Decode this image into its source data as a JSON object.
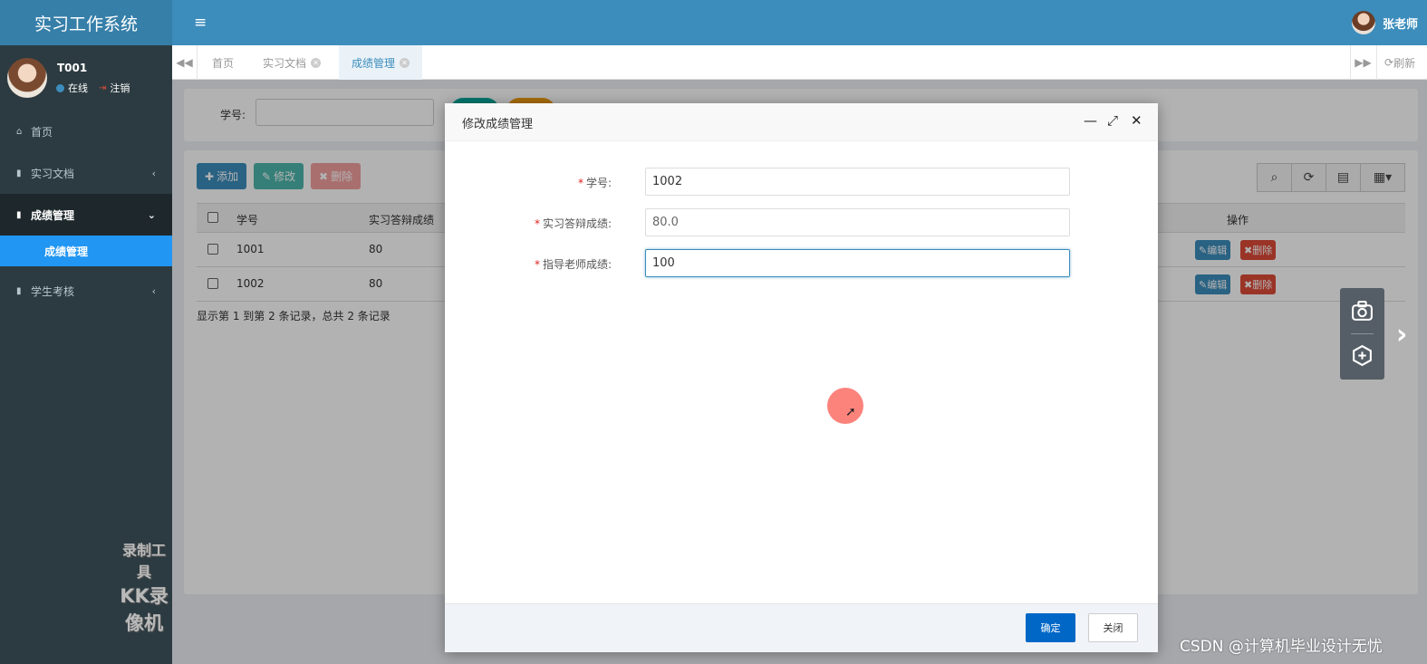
{
  "app": {
    "title": "实习工作系统"
  },
  "header": {
    "user_name": "张老师"
  },
  "sidebar": {
    "user": {
      "id": "T001",
      "status": "在线",
      "logout": "注销"
    },
    "items": [
      {
        "label": "首页",
        "icon": "home-icon"
      },
      {
        "label": "实习文档",
        "icon": "book-icon",
        "chevron": "‹"
      },
      {
        "label": "成绩管理",
        "icon": "book-icon",
        "chevron": "⌄"
      },
      {
        "label": "学生考核",
        "icon": "book-icon",
        "chevron": "‹"
      }
    ],
    "subitem": "成绩管理"
  },
  "tabs": [
    {
      "label": "首页"
    },
    {
      "label": "实习文档"
    },
    {
      "label": "成绩管理"
    }
  ],
  "tabbar": {
    "refresh": "刷新"
  },
  "search": {
    "label": "学号:"
  },
  "toolbar": {
    "add": "添加",
    "edit": "修改",
    "delete": "删除"
  },
  "table": {
    "headers": {
      "check": "",
      "student_id": "学号",
      "defense_score": "实习答辩成绩",
      "actions": "操作"
    },
    "rows": [
      {
        "student_id": "1001",
        "defense_score": "80",
        "edit": "编辑",
        "delete": "删除"
      },
      {
        "student_id": "1002",
        "defense_score": "80",
        "edit": "编辑",
        "delete": "删除"
      }
    ],
    "footer": "显示第 1 到第 2 条记录，总共 2 条记录"
  },
  "modal": {
    "title": "修改成绩管理",
    "fields": [
      {
        "label": "学号:",
        "value": "1002"
      },
      {
        "label": "实习答辩成绩:",
        "value": "80.0"
      },
      {
        "label": "指导老师成绩:",
        "value": "100"
      }
    ],
    "ok": "确定",
    "close": "关闭"
  },
  "overlay_text": {
    "recorder_line1": "录制工具",
    "recorder_line2": "KK录像机",
    "csdn": "CSDN @计算机毕业设计无忧"
  },
  "colors": {
    "header": "#3c8dbc",
    "sidebar": "#2c3b41",
    "active_sub": "#2196f3",
    "primary_btn": "#0067c7",
    "danger": "#dd4b39"
  }
}
